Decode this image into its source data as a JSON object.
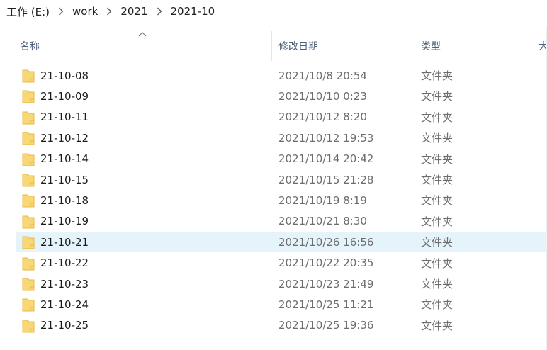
{
  "breadcrumb": {
    "items": [
      "工作 (E:)",
      "work",
      "2021",
      "2021-10"
    ]
  },
  "columns": {
    "name": "名称",
    "date_modified": "修改日期",
    "type": "类型",
    "size_partial": "大"
  },
  "colors": {
    "selected_row": "#e5f3fb",
    "folder_body": "#f8d775",
    "folder_tab": "#e8b94a"
  },
  "files": [
    {
      "name": "21-10-08",
      "date": "2021/10/8 20:54",
      "type": "文件夹"
    },
    {
      "name": "21-10-09",
      "date": "2021/10/10 0:23",
      "type": "文件夹"
    },
    {
      "name": "21-10-11",
      "date": "2021/10/12 8:20",
      "type": "文件夹"
    },
    {
      "name": "21-10-12",
      "date": "2021/10/12 19:53",
      "type": "文件夹"
    },
    {
      "name": "21-10-14",
      "date": "2021/10/14 20:42",
      "type": "文件夹"
    },
    {
      "name": "21-10-15",
      "date": "2021/10/15 21:28",
      "type": "文件夹"
    },
    {
      "name": "21-10-18",
      "date": "2021/10/19 8:19",
      "type": "文件夹"
    },
    {
      "name": "21-10-19",
      "date": "2021/10/21 8:30",
      "type": "文件夹"
    },
    {
      "name": "21-10-21",
      "date": "2021/10/26 16:56",
      "type": "文件夹",
      "selected": true
    },
    {
      "name": "21-10-22",
      "date": "2021/10/22 20:35",
      "type": "文件夹"
    },
    {
      "name": "21-10-23",
      "date": "2021/10/23 21:49",
      "type": "文件夹"
    },
    {
      "name": "21-10-24",
      "date": "2021/10/25 11:21",
      "type": "文件夹"
    },
    {
      "name": "21-10-25",
      "date": "2021/10/25 19:36",
      "type": "文件夹"
    }
  ]
}
